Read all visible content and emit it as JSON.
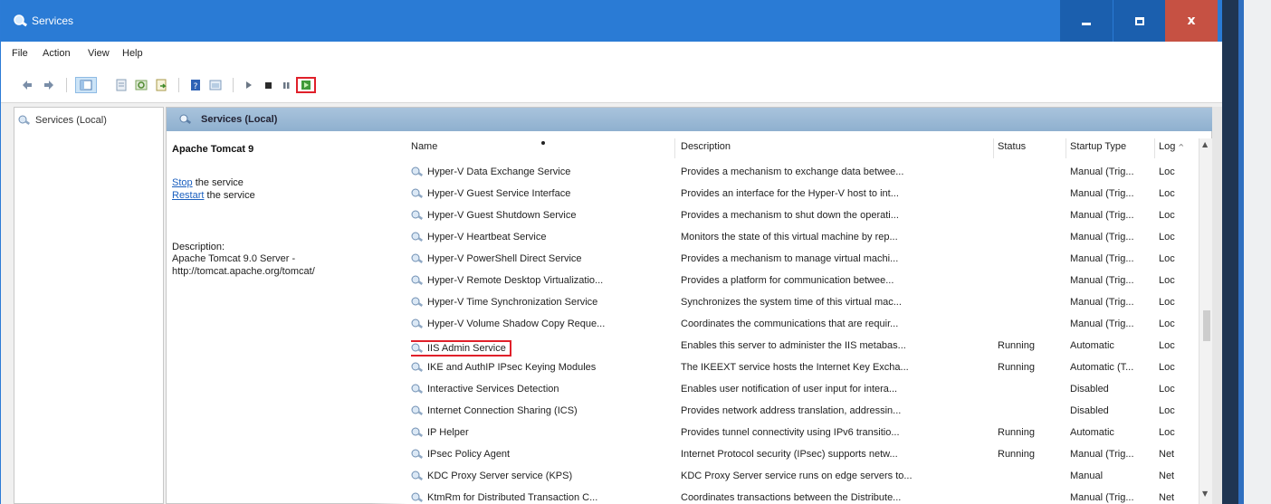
{
  "window": {
    "title": "Services",
    "controls": {
      "minimize": "–",
      "maximize": "□",
      "close": "x"
    }
  },
  "menu": [
    "File",
    "Action",
    "View",
    "Help"
  ],
  "toolbar": {
    "icons": [
      "back-arrow-icon",
      "forward-arrow-icon",
      "console-tree-icon",
      "properties-icon",
      "refresh-icon",
      "export-list-icon",
      "help-icon",
      "mmc-view-icon",
      "start-service-icon",
      "stop-service-icon",
      "pause-service-icon",
      "restart-service-icon"
    ],
    "highlighted": "restart-service-icon"
  },
  "tree": {
    "item": "Services (Local)"
  },
  "content_header": {
    "title": "Services (Local)"
  },
  "extended": {
    "service_name": "Apache Tomcat 9",
    "stop_link": "Stop",
    "stop_text": " the service",
    "restart_link": "Restart",
    "restart_text": " the service",
    "description_label": "Description:",
    "description": "Apache Tomcat 9.0 Server - http://tomcat.apache.org/tomcat/"
  },
  "columns": {
    "name": "Name",
    "description": "Description",
    "status": "Status",
    "startup": "Startup Type",
    "logon": "Log"
  },
  "services": [
    {
      "name": "Hyper-V Data Exchange Service",
      "description": "Provides a mechanism to exchange data betwee...",
      "status": "",
      "startup": "Manual (Trig...",
      "logon": "Loc"
    },
    {
      "name": "Hyper-V Guest Service Interface",
      "description": "Provides an interface for the Hyper-V host to int...",
      "status": "",
      "startup": "Manual (Trig...",
      "logon": "Loc"
    },
    {
      "name": "Hyper-V Guest Shutdown Service",
      "description": "Provides a mechanism to shut down the operati...",
      "status": "",
      "startup": "Manual (Trig...",
      "logon": "Loc"
    },
    {
      "name": "Hyper-V Heartbeat Service",
      "description": "Monitors the state of this virtual machine by rep...",
      "status": "",
      "startup": "Manual (Trig...",
      "logon": "Loc"
    },
    {
      "name": "Hyper-V PowerShell Direct Service",
      "description": "Provides a mechanism to manage virtual machi...",
      "status": "",
      "startup": "Manual (Trig...",
      "logon": "Loc"
    },
    {
      "name": "Hyper-V Remote Desktop Virtualizatio...",
      "description": "Provides a platform for communication betwee...",
      "status": "",
      "startup": "Manual (Trig...",
      "logon": "Loc"
    },
    {
      "name": "Hyper-V Time Synchronization Service",
      "description": "Synchronizes the system time of this virtual mac...",
      "status": "",
      "startup": "Manual (Trig...",
      "logon": "Loc"
    },
    {
      "name": "Hyper-V Volume Shadow Copy Reque...",
      "description": "Coordinates the communications that are requir...",
      "status": "",
      "startup": "Manual (Trig...",
      "logon": "Loc"
    },
    {
      "name": "IIS Admin Service",
      "description": "Enables this server to administer the IIS metabas...",
      "status": "Running",
      "startup": "Automatic",
      "logon": "Loc"
    },
    {
      "name": "IKE and AuthIP IPsec Keying Modules",
      "description": "The IKEEXT service hosts the Internet Key Excha...",
      "status": "Running",
      "startup": "Automatic (T...",
      "logon": "Loc"
    },
    {
      "name": "Interactive Services Detection",
      "description": "Enables user notification of user input for intera...",
      "status": "",
      "startup": "Disabled",
      "logon": "Loc"
    },
    {
      "name": "Internet Connection Sharing (ICS)",
      "description": "Provides network address translation, addressin...",
      "status": "",
      "startup": "Disabled",
      "logon": "Loc"
    },
    {
      "name": "IP Helper",
      "description": "Provides tunnel connectivity using IPv6 transitio...",
      "status": "Running",
      "startup": "Automatic",
      "logon": "Loc"
    },
    {
      "name": "IPsec Policy Agent",
      "description": "Internet Protocol security (IPsec) supports netw...",
      "status": "Running",
      "startup": "Manual (Trig...",
      "logon": "Net"
    },
    {
      "name": "KDC Proxy Server service (KPS)",
      "description": "KDC Proxy Server service runs on edge servers to...",
      "status": "",
      "startup": "Manual",
      "logon": "Net"
    },
    {
      "name": "KtmRm for Distributed Transaction C...",
      "description": "Coordinates transactions between the Distribute...",
      "status": "",
      "startup": "Manual (Trig...",
      "logon": "Net"
    }
  ],
  "highlighted_service": "IIS Admin Service",
  "colors": {
    "titlebar": "#2a7bd5",
    "close": "#c65143",
    "highlight_box": "#e0202a",
    "link": "#1a5fbf"
  }
}
